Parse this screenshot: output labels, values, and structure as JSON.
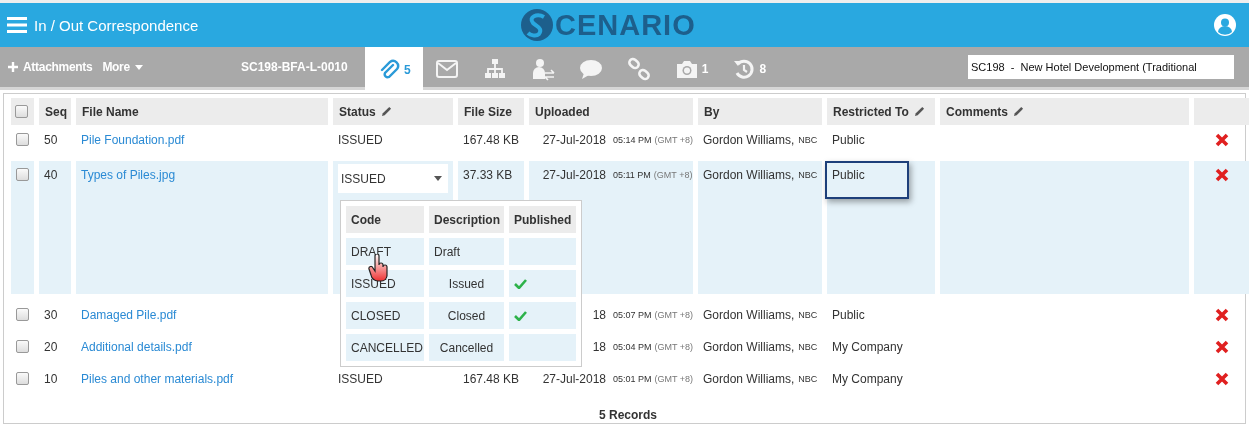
{
  "header": {
    "title": "In / Out Correspondence",
    "logo": "CENARIO"
  },
  "toolbar": {
    "actions": [
      {
        "kind": "add",
        "label": "Attachments"
      },
      {
        "kind": "menu",
        "label": "More"
      }
    ],
    "record_id": "SC198-BFA-L-0010",
    "tabs": [
      {
        "kind": "attachments",
        "count": "5",
        "selected": true
      },
      {
        "kind": "mail",
        "selected": false
      },
      {
        "kind": "hierarchy",
        "selected": false
      },
      {
        "kind": "transfer",
        "selected": false
      },
      {
        "kind": "chat",
        "selected": false
      },
      {
        "kind": "link",
        "selected": false
      },
      {
        "kind": "camera",
        "count": "1",
        "selected": false
      },
      {
        "kind": "history",
        "count": "8",
        "selected": false
      }
    ],
    "project_field": {
      "value": "SC198  -  New Hotel Development (Traditional"
    }
  },
  "table": {
    "columns": [
      {
        "kind": "checkbox",
        "checked": false
      },
      {
        "label": "Seq"
      },
      {
        "label": "File Name",
        "editable": false
      },
      {
        "label": "Status",
        "editable": true
      },
      {
        "label": "File Size",
        "editable": false
      },
      {
        "label": "Uploaded",
        "editable": false
      },
      {
        "label": "By",
        "editable": false
      },
      {
        "label": "Restricted To",
        "editable": true
      },
      {
        "label": "Comments",
        "editable": true
      },
      {
        "kind": "action"
      }
    ],
    "rows": [
      {
        "checked": false,
        "selected": false,
        "seq": "50",
        "file_name": "Pile Foundation.pdf",
        "status": "ISSUED",
        "size": "167.48 KB",
        "date": "27-Jul-2018",
        "time": "05:14 PM",
        "zone": "(GMT +8)",
        "by": "Gordon Williams,",
        "company": "NBC",
        "restricted": "Public"
      },
      {
        "checked": false,
        "selected": true,
        "seq": "40",
        "file_name": "Types of Piles.jpg",
        "status": "ISSUED",
        "status_editing": true,
        "size": "37.33 KB",
        "date": "27-Jul-2018",
        "time": "05:11 PM",
        "zone": "(GMT +8)",
        "by": "Gordon Williams,",
        "company": "NBC",
        "restricted": "Public",
        "restricted_focused": true
      },
      {
        "checked": false,
        "selected": false,
        "seq": "30",
        "file_name": "Damaged Pile.pdf",
        "date": "18",
        "time": "05:07 PM",
        "zone": "(GMT +8)",
        "by": "Gordon Williams,",
        "company": "NBC",
        "restricted": "Public"
      },
      {
        "checked": false,
        "selected": false,
        "seq": "20",
        "file_name": "Additional details.pdf",
        "date": "18",
        "time": "05:04 PM",
        "zone": "(GMT +8)",
        "by": "Gordon Williams,",
        "company": "NBC",
        "restricted": "My Company"
      },
      {
        "checked": false,
        "selected": false,
        "seq": "10",
        "file_name": "Piles and other materials.pdf",
        "status": "ISSUED",
        "size": "167.48 KB",
        "date": "27-Jul-2018",
        "time": "05:01 PM",
        "zone": "(GMT +8)",
        "by": "Gordon Williams,",
        "company": "NBC",
        "restricted": "My Company"
      }
    ],
    "status_dropdown": {
      "columns": [
        "Code",
        "Description",
        "Published"
      ],
      "options": [
        {
          "code": "DRAFT",
          "description": "Draft",
          "published": false,
          "hovered": true
        },
        {
          "code": "ISSUED",
          "description": "Issued",
          "published": true,
          "hovered": false
        },
        {
          "code": "CLOSED",
          "description": "Closed",
          "published": true,
          "hovered": false
        },
        {
          "code": "CANCELLED",
          "description": "Cancelled",
          "published": false,
          "hovered": false
        }
      ]
    },
    "footer": "5 Records"
  }
}
